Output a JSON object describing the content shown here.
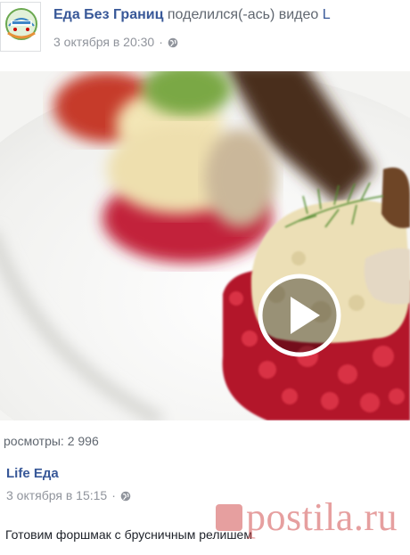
{
  "header": {
    "page_name": "Еда Без Границ",
    "shared_text": "поделился(-ась) видео",
    "shared_link_fragment": "L",
    "timestamp": "3 октября в 20:30",
    "separator": "·",
    "privacy_icon": "globe-icon"
  },
  "video": {
    "play_icon": "play-icon",
    "thumbnail_subject": "food-photo"
  },
  "footer": {
    "views": "росмотры: 2 996",
    "shared_author": "Life Еда",
    "shared_timestamp": "3 октября в 15:15",
    "separator": "·",
    "privacy_icon": "globe-icon",
    "post_text": "Готовим форшмак с брусничным релишем"
  },
  "watermark": {
    "text": "postila.ru"
  },
  "colors": {
    "link": "#385898",
    "meta": "#90949c",
    "text": "#1d2129"
  }
}
